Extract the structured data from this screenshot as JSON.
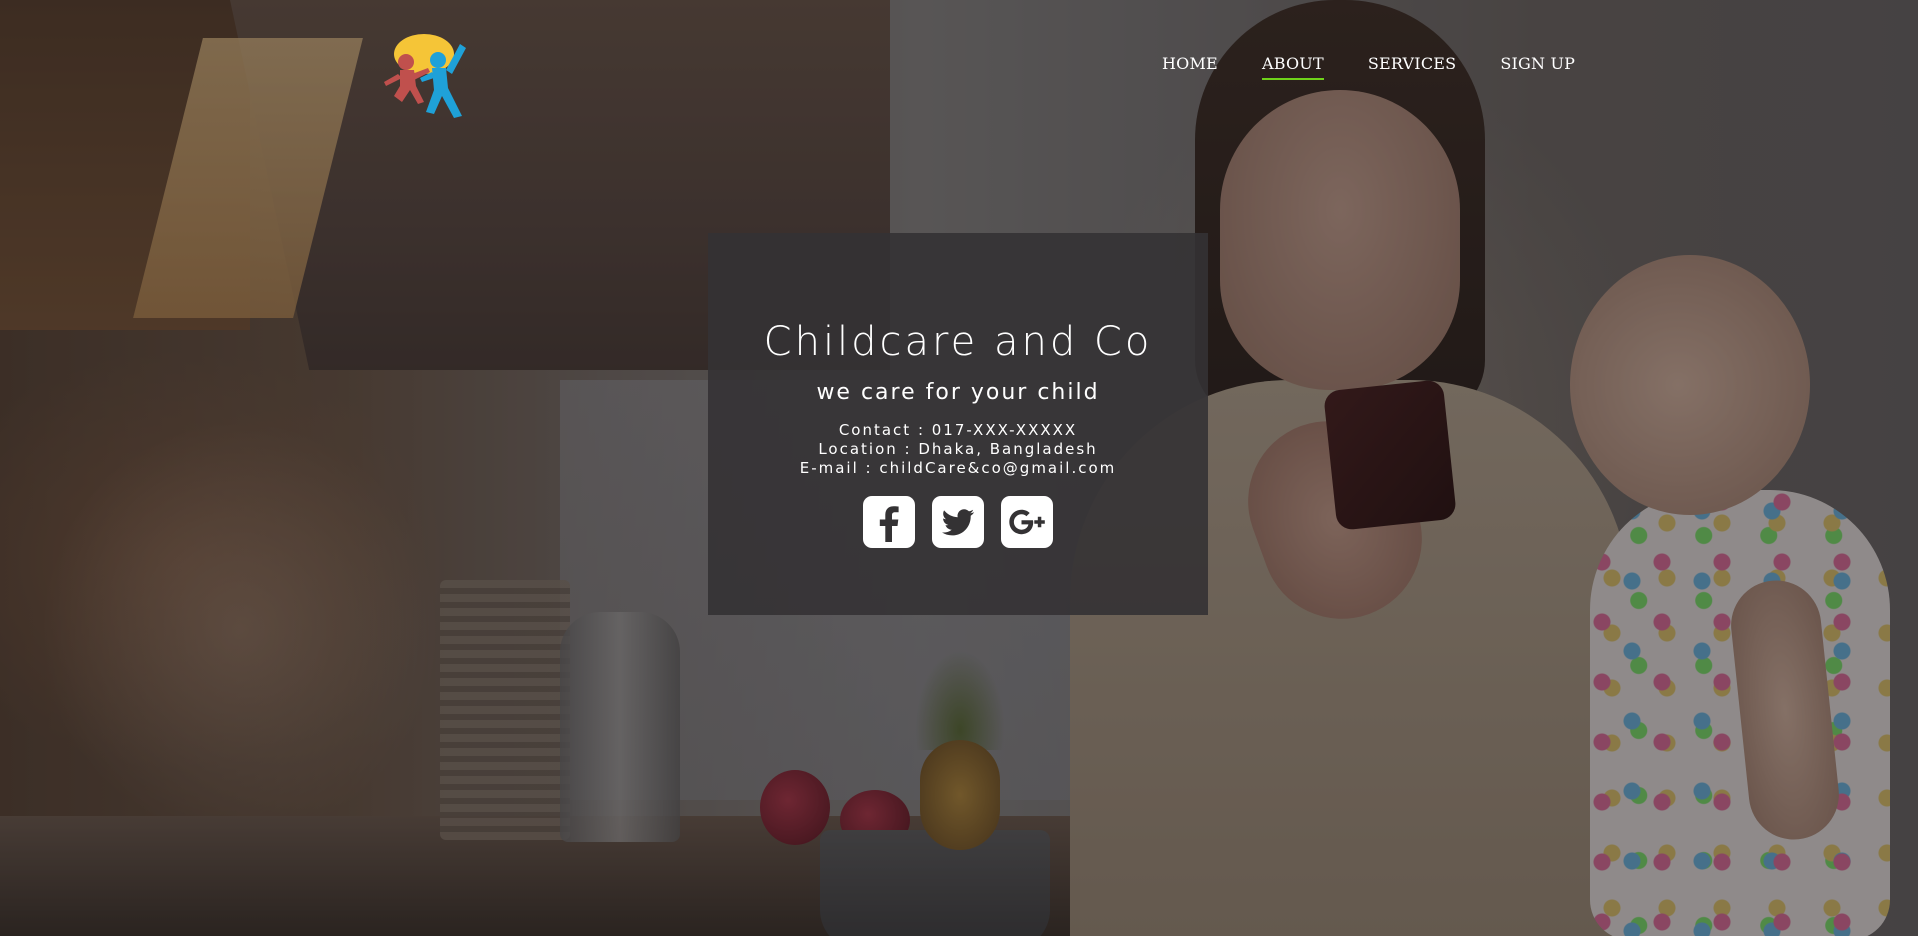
{
  "header": {
    "logo_alt": "Childcare and Co logo",
    "nav": [
      {
        "label": "HOME",
        "active": false
      },
      {
        "label": "ABOUT",
        "active": true
      },
      {
        "label": "SERVICES",
        "active": false
      },
      {
        "label": "SIGN UP",
        "active": false
      }
    ]
  },
  "hero": {
    "title": "Childcare and Co",
    "subtitle": "we care for your child",
    "contact": "Contact : 017-XXX-XXXXX",
    "location": "Location : Dhaka, Bangladesh",
    "email": "E-mail : childCare&co@gmail.com",
    "social": [
      {
        "icon": "facebook-icon"
      },
      {
        "icon": "twitter-icon"
      },
      {
        "icon": "google-plus-icon"
      }
    ]
  },
  "colors": {
    "nav_active_underline": "#6fd21a",
    "hero_box": "#343234",
    "logo_yellow": "#f5c537",
    "logo_red": "#c0504d",
    "logo_blue": "#1fa1d8"
  }
}
